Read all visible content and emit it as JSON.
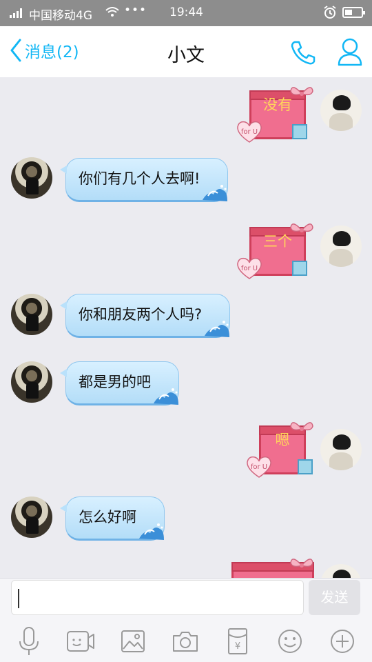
{
  "status_bar": {
    "carrier": "中国移动4G",
    "time": "19:44",
    "icons": [
      "signal-icon",
      "wifi-icon",
      "more-dots-icon",
      "alarm-icon",
      "battery-icon"
    ]
  },
  "header": {
    "back_label": "消息(2)",
    "title": "小文",
    "icons": [
      "chevron-left-icon",
      "phone-icon",
      "profile-icon"
    ]
  },
  "colors": {
    "accent": "#12b7f5",
    "bubble": "#c8e8fc",
    "gift_box": "#f06e8f",
    "gift_text": "#ffd65a",
    "background": "#ebebf0"
  },
  "messages": [
    {
      "side": "right",
      "type": "gift",
      "text": "没有"
    },
    {
      "side": "left",
      "type": "text",
      "text": "你们有几个人去啊!"
    },
    {
      "side": "right",
      "type": "gift",
      "text": "三个"
    },
    {
      "side": "left",
      "type": "text",
      "text": "你和朋友两个人吗?"
    },
    {
      "side": "left",
      "type": "text",
      "text": "都是男的吧"
    },
    {
      "side": "right",
      "type": "gift",
      "text": "嗯"
    },
    {
      "side": "left",
      "type": "text",
      "text": "怎么好啊"
    },
    {
      "side": "right",
      "type": "gift",
      "text": ""
    }
  ],
  "gift_tag": "for U",
  "input": {
    "value": "",
    "placeholder": "",
    "send_label": "发送"
  },
  "toolbar": {
    "icons": [
      "microphone-icon",
      "video-icon",
      "image-icon",
      "camera-icon",
      "red-packet-icon",
      "emoji-icon",
      "plus-icon"
    ],
    "red_packet_symbol": "¥"
  }
}
